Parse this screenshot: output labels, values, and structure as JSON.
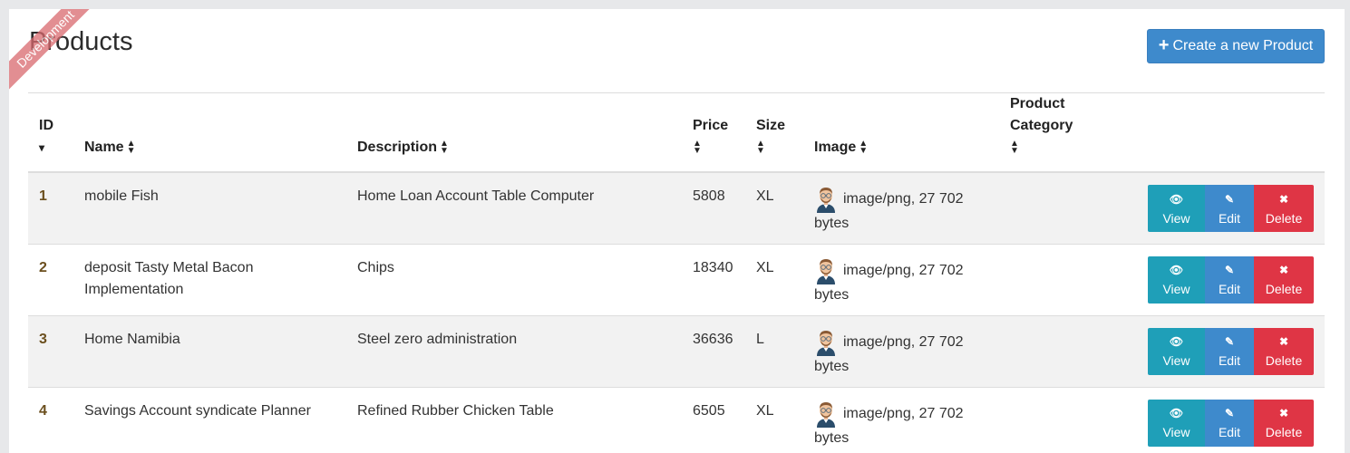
{
  "ribbon": "Development",
  "page": {
    "title": "Products",
    "create_label": "Create a new Product"
  },
  "table": {
    "headers": {
      "id": "ID",
      "name": "Name",
      "description": "Description",
      "price": "Price",
      "size": "Size",
      "image": "Image",
      "category": "Product Category"
    },
    "rows": [
      {
        "id": "1",
        "name": "mobile Fish",
        "description": "Home Loan Account Table Computer",
        "price": "5808",
        "size": "XL",
        "image": "image/png, 27 702 bytes",
        "category": ""
      },
      {
        "id": "2",
        "name": "deposit Tasty Metal Bacon Implementation",
        "description": "Chips",
        "price": "18340",
        "size": "XL",
        "image": "image/png, 27 702 bytes",
        "category": ""
      },
      {
        "id": "3",
        "name": "Home Namibia",
        "description": "Steel zero administration",
        "price": "36636",
        "size": "L",
        "image": "image/png, 27 702 bytes",
        "category": ""
      },
      {
        "id": "4",
        "name": "Savings Account syndicate Planner",
        "description": "Refined Rubber Chicken Table",
        "price": "6505",
        "size": "XL",
        "image": "image/png, 27 702 bytes",
        "category": ""
      }
    ],
    "actions": {
      "view": "View",
      "edit": "Edit",
      "delete": "Delete"
    }
  },
  "icons": {
    "create": "plus-icon",
    "sort": "sort-icon",
    "view": "eye-icon",
    "edit": "pencil-icon",
    "delete": "times-icon",
    "thumbnail": "avatar-icon"
  },
  "colors": {
    "primary": "#3e8acc",
    "info": "#1f9fb8",
    "danger": "#df3545",
    "ribbon": "#d9696e"
  }
}
